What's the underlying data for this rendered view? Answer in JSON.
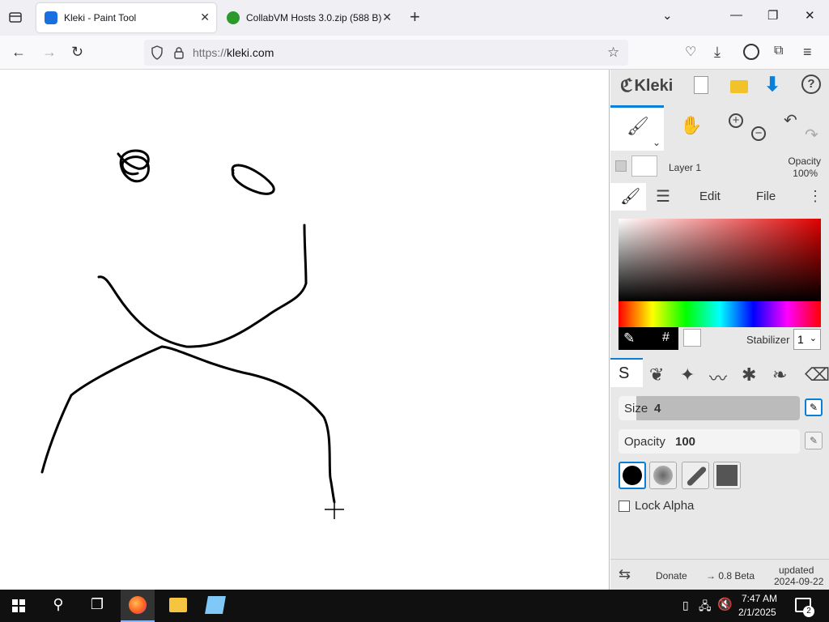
{
  "browser": {
    "tabs": [
      {
        "title": "Kleki - Paint Tool",
        "active": true
      },
      {
        "title": "CollabVM Hosts 3.0.zip (588 B)",
        "active": false
      }
    ],
    "url_protocol": "https://",
    "url_host": "kleki.com",
    "new_tab_label": "+",
    "close_glyph": "✕"
  },
  "kleki": {
    "logo": "Kleki",
    "layer": {
      "name": "Layer 1",
      "opacity_label": "Opacity",
      "opacity_value": "100%"
    },
    "menu_tabs": [
      "Edit",
      "File"
    ],
    "hash_label": "#",
    "stabilizer_label": "Stabilizer",
    "stabilizer_value": "1",
    "size_label": "Size",
    "size_value": "4",
    "size_fill_fraction": 0.1,
    "opacity_label": "Opacity",
    "opacity_value": "100",
    "lock_alpha_label": "Lock Alpha",
    "donate_label": "Donate",
    "version_label": "→ 0.8 Beta",
    "updated_label": "updated",
    "updated_date": "2024-09-22",
    "colors": {
      "accent": "#0a7fd8",
      "primary": "#000000",
      "secondary": "#ffffff"
    }
  },
  "taskbar": {
    "time": "7:47 AM",
    "date": "2/1/2025",
    "notification_count": "2"
  }
}
